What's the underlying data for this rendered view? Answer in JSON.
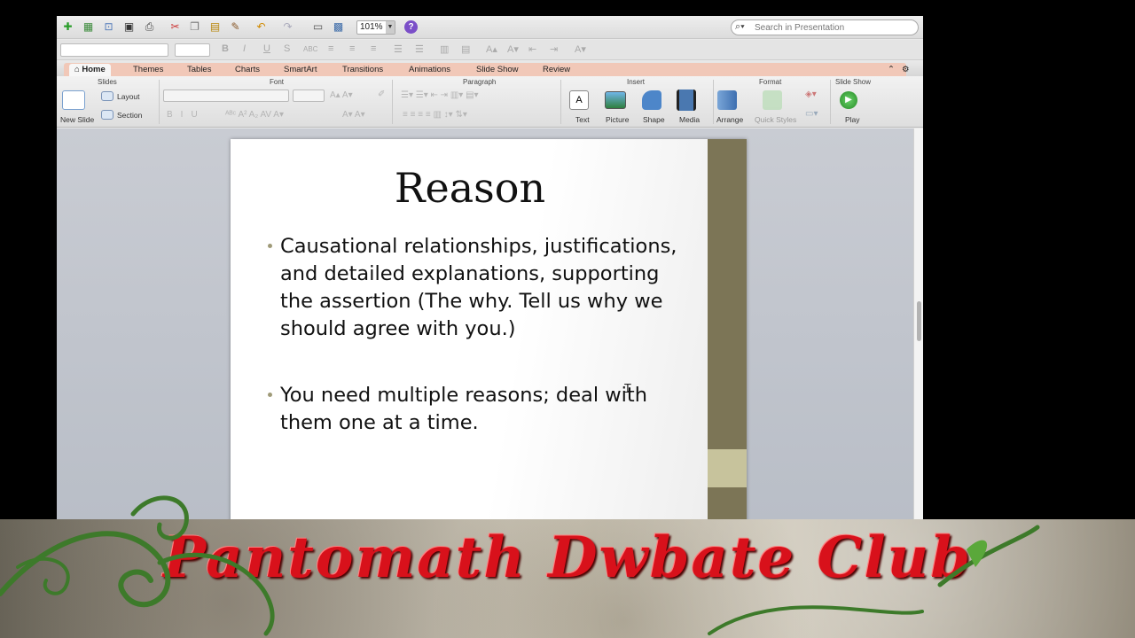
{
  "toolbar": {
    "zoom_value": "101%",
    "help_glyph": "?",
    "search_placeholder": "Search in Presentation"
  },
  "tabs": [
    "Home",
    "Themes",
    "Tables",
    "Charts",
    "SmartArt",
    "Transitions",
    "Animations",
    "Slide Show",
    "Review"
  ],
  "ribbon": {
    "groups": {
      "slides": "Slides",
      "font": "Font",
      "paragraph": "Paragraph",
      "insert": "Insert",
      "format": "Format",
      "slide_show": "Slide Show"
    },
    "new_slide": "New Slide",
    "layout": "Layout",
    "section": "Section",
    "text": "Text",
    "picture": "Picture",
    "shape": "Shape",
    "media": "Media",
    "arrange": "Arrange",
    "quick_styles": "Quick Styles",
    "play": "Play"
  },
  "slide": {
    "title": "Reason",
    "bullets": [
      "Causational relationships, justifications, and detailed explanations, supporting the assertion (The why. Tell us why we should agree with you.)",
      "You need multiple reasons; deal with them one at a time."
    ]
  },
  "banner": {
    "title": "Pantomath Dwbate Club"
  },
  "icons": [
    "new-doc-icon",
    "gallery-icon",
    "open-icon",
    "save-icon",
    "print-icon",
    "cut-icon",
    "copy-icon",
    "paste-icon",
    "format-painter-icon",
    "undo-icon",
    "redo-icon",
    "slide-sorter-icon",
    "presenter-icon",
    "help-icon",
    "search-icon",
    "play-icon"
  ]
}
